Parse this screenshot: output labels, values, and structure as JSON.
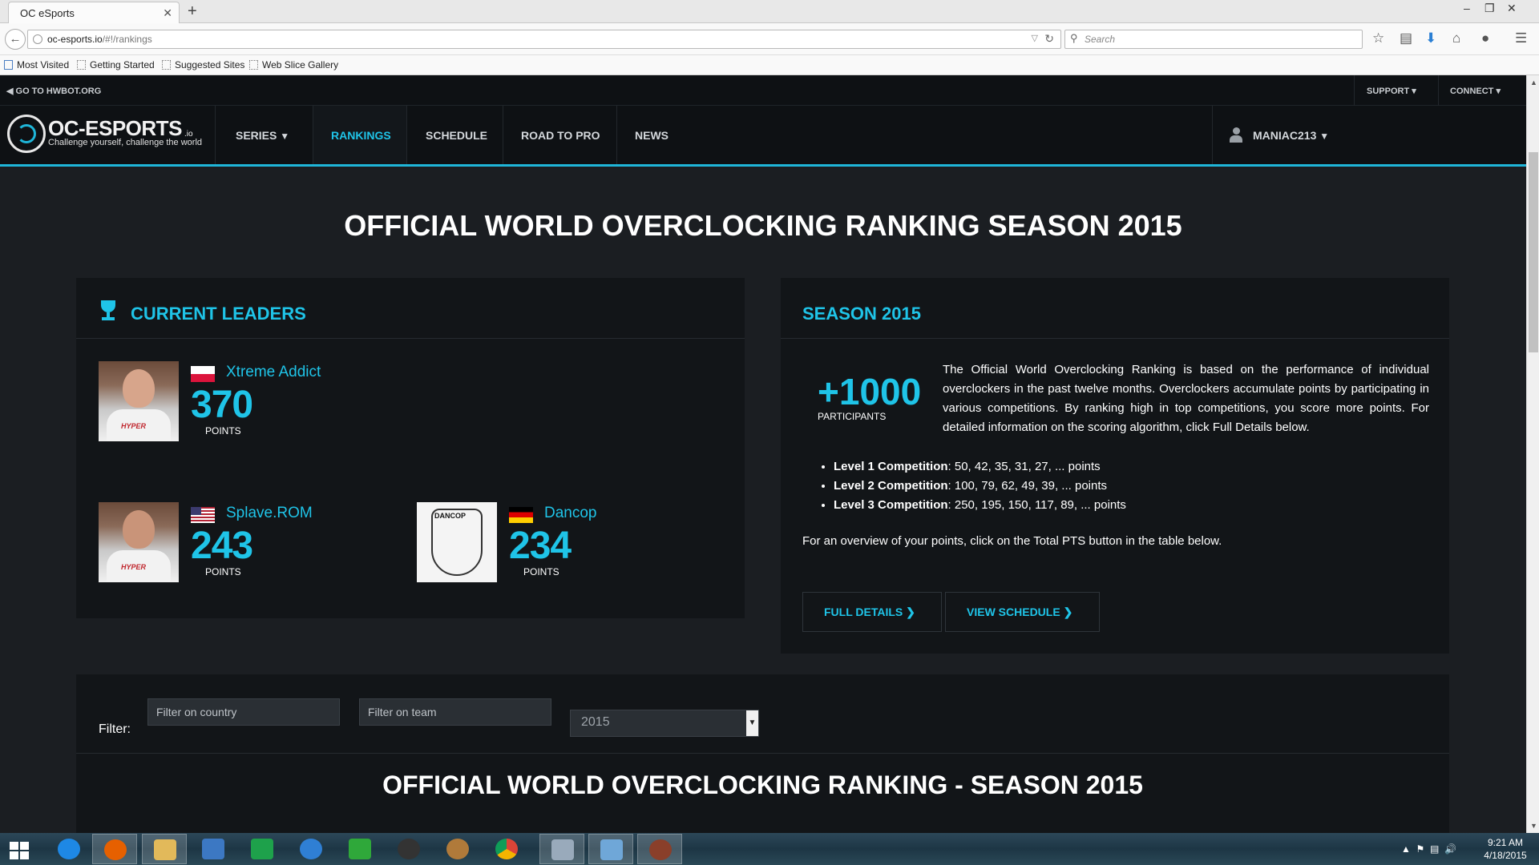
{
  "browser": {
    "tab_title": "OC eSports",
    "tab_close": "✕",
    "new_tab": "+",
    "url_host": "oc-esports.io",
    "url_path": "/#!/rankings",
    "search_placeholder": "Search",
    "bookmarks": [
      "Most Visited",
      "Getting Started",
      "Suggested Sites",
      "Web Slice Gallery"
    ]
  },
  "site": {
    "goto_hwbot": "GO TO HWBOT.ORG",
    "top_menus": [
      "SUPPORT",
      "CONNECT"
    ],
    "logo_name": "OC-ESPORTS",
    "logo_suffix": ".io",
    "logo_tagline": "Challenge yourself, challenge the world",
    "nav": [
      "SERIES",
      "RANKINGS",
      "SCHEDULE",
      "ROAD TO PRO",
      "NEWS"
    ],
    "active_nav": "RANKINGS",
    "username": "MANIAC213"
  },
  "page_title": "OFFICIAL WORLD OVERCLOCKING RANKING SEASON 2015",
  "leaders": {
    "title": "CURRENT LEADERS",
    "points_label": "POINTS",
    "entries": [
      {
        "name": "Xtreme Addict",
        "points": "370",
        "country": "Poland"
      },
      {
        "name": "Splave.ROM",
        "points": "243",
        "country": "United States"
      },
      {
        "name": "Dancop",
        "points": "234",
        "country": "Germany"
      }
    ]
  },
  "season": {
    "title": "SEASON 2015",
    "participants_value": "+1000",
    "participants_label": "PARTICIPANTS",
    "description": "The Official World Overclocking Ranking is based on the performance of individual overclockers in the past twelve months. Overclockers accumulate points by participating in various competitions. By ranking high in top competitions, you score more points. For detailed information on the scoring algorithm, click Full Details below.",
    "levels": [
      {
        "label": "Level 1 Competition",
        "points": ": 50, 42, 35, 31, 27, ... points"
      },
      {
        "label": "Level 2 Competition",
        "points": ": 100, 79, 62, 49, 39, ... points"
      },
      {
        "label": "Level 3 Competition",
        "points": ": 250, 195, 150, 117, 89, ... points"
      }
    ],
    "overview": "For an overview of your points, click on the Total PTS button in the table below.",
    "buttons": [
      "FULL DETAILS",
      "VIEW SCHEDULE"
    ]
  },
  "filter": {
    "label": "Filter:",
    "country_placeholder": "Filter on country",
    "team_placeholder": "Filter on team",
    "year_value": "2015"
  },
  "table_title": "OFFICIAL WORLD OVERCLOCKING RANKING - SEASON 2015",
  "taskbar": {
    "time": "9:21 AM",
    "date": "4/18/2015"
  }
}
